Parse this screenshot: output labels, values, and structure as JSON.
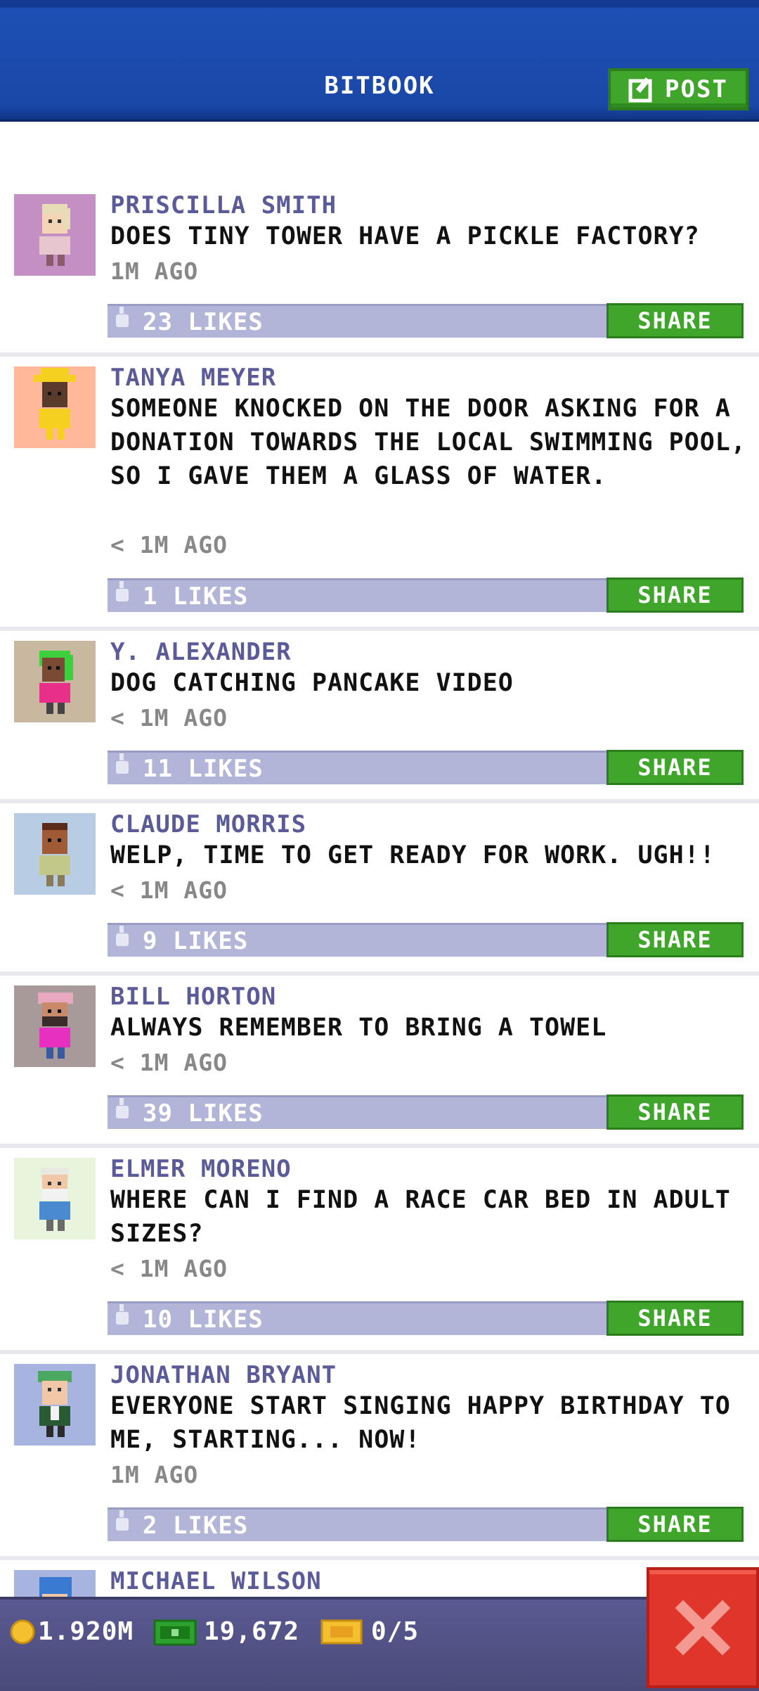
{
  "header": {
    "title": "BITBOOK",
    "post_label": "POST",
    "post_icon": "edit-icon"
  },
  "posts": [
    {
      "author": "PRISCILLA SMITH",
      "message": "DOES TINY TOWER HAVE A PICKLE FACTORY?",
      "time": "1M AGO",
      "likes": "23 LIKES",
      "share": "SHARE",
      "avatar_bg": "#c490c4"
    },
    {
      "author": "TANYA MEYER",
      "message": "SOMEONE KNOCKED ON THE DOOR ASKING FOR A DONATION TOWARDS THE LOCAL SWIMMING POOL, SO I GAVE THEM A GLASS OF WATER.",
      "time": "< 1M AGO",
      "likes": "1 LIKES",
      "share": "SHARE",
      "avatar_bg": "#ffb89a"
    },
    {
      "author": "Y. ALEXANDER",
      "message": "DOG CATCHING PANCAKE VIDEO",
      "time": "< 1M AGO",
      "likes": "11 LIKES",
      "share": "SHARE",
      "avatar_bg": "#c8b8a0"
    },
    {
      "author": "CLAUDE MORRIS",
      "message": "WELP, TIME TO GET READY FOR WORK. UGH!!",
      "time": "< 1M AGO",
      "likes": "9 LIKES",
      "share": "SHARE",
      "avatar_bg": "#b8cce4"
    },
    {
      "author": "BILL HORTON",
      "message": "ALWAYS REMEMBER TO BRING A TOWEL",
      "time": "< 1M AGO",
      "likes": "39 LIKES",
      "share": "SHARE",
      "avatar_bg": "#a89a9a"
    },
    {
      "author": "ELMER MORENO",
      "message": "WHERE CAN I FIND A RACE CAR BED IN ADULT SIZES?",
      "time": "< 1M AGO",
      "likes": "10 LIKES",
      "share": "SHARE",
      "avatar_bg": "#e8f4dc"
    },
    {
      "author": "JONATHAN BRYANT",
      "message": "EVERYONE START SINGING HAPPY BIRTHDAY TO ME, STARTING... NOW!",
      "time": "1M AGO",
      "likes": "2 LIKES",
      "share": "SHARE",
      "avatar_bg": "#a8b4e0"
    },
    {
      "author": "MICHAEL WILSON",
      "avatar_bg": "#a8b4e0"
    }
  ],
  "status": {
    "coins": "1.920M",
    "bux": "19,672",
    "tickets": "0/5"
  },
  "close_icon": "close-icon"
}
